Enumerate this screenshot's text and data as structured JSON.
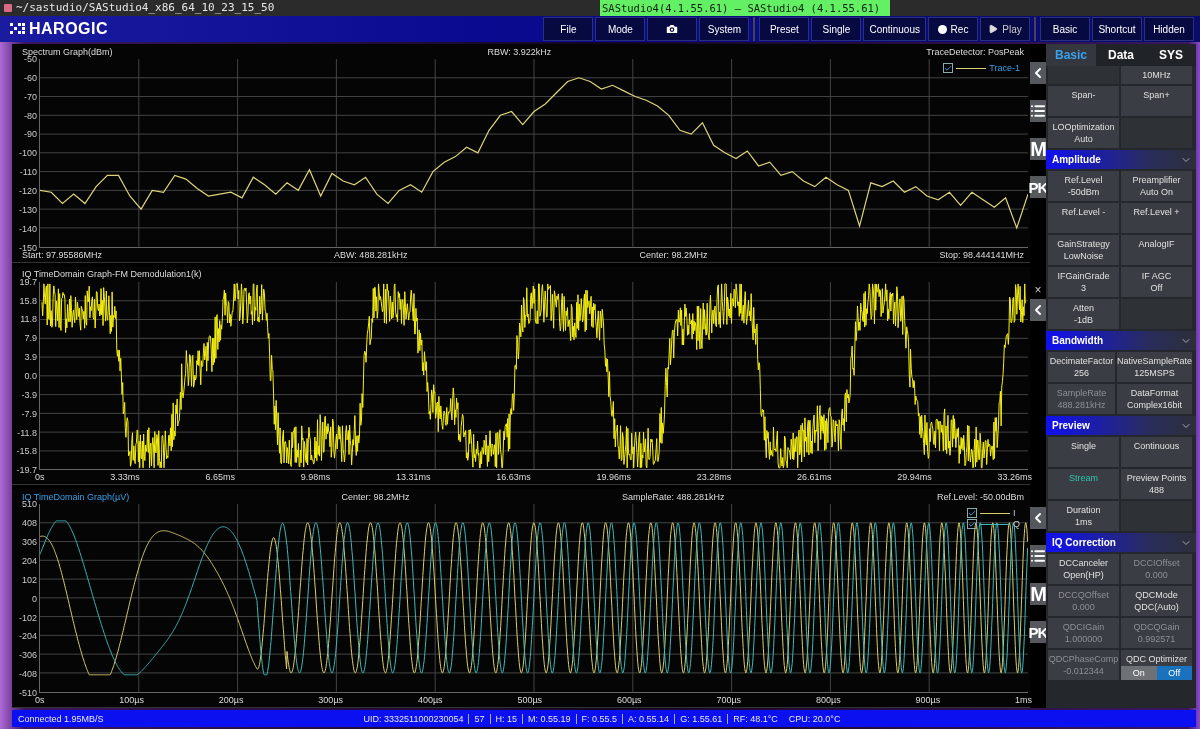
{
  "titlebar": {
    "path": "~/sastudio/SAStudio4_x86_64_10_23_15_50",
    "app": "SAStudio4(4.1.55.61) — SAStudio4 (4.1.55.61)"
  },
  "toolbar": {
    "logo": "HAROGIC",
    "groups": [
      [
        {
          "kind": "text",
          "label": "File"
        },
        {
          "kind": "text",
          "label": "Mode"
        },
        {
          "kind": "camera"
        },
        {
          "kind": "text",
          "label": "System"
        }
      ],
      [
        {
          "kind": "text",
          "label": "Preset"
        },
        {
          "kind": "text",
          "label": "Single"
        },
        {
          "kind": "text",
          "label": "Continuous"
        },
        {
          "kind": "rec",
          "label": "Rec"
        },
        {
          "kind": "play",
          "label": "Play"
        }
      ],
      [
        {
          "kind": "text",
          "label": "Basic"
        },
        {
          "kind": "text",
          "label": "Shortcut"
        },
        {
          "kind": "text",
          "label": "Hidden"
        }
      ]
    ]
  },
  "graphs": [
    {
      "kind": "spectrum",
      "selected": false,
      "title": "Spectrum Graph(dBm)",
      "info": [
        "RBW: 3.922kHz",
        "TraceDetector: PosPeak"
      ],
      "footer": [
        "Start: 97.95586MHz",
        "ABW: 488.281kHz",
        "Center: 98.2MHz",
        "Stop: 98.444141MHz"
      ],
      "legend": [
        {
          "checked": true
        }
      ],
      "chart_data": {
        "type": "line",
        "grid": true,
        "ylim": [
          -150,
          -50
        ],
        "yticks": [
          -50,
          -60,
          -70,
          -80,
          -90,
          -100,
          -110,
          -120,
          -130,
          -140,
          -150
        ],
        "series": [
          {
            "name": "Trace-1",
            "color": "#ddd47a",
            "values": [
              -120,
              -121,
              -127,
              -122,
              -127,
              -118,
              -112,
              -112,
              -123,
              -130,
              -120,
              -121,
              -112,
              -114,
              -119,
              -123,
              -122,
              -121,
              -124,
              -113,
              -117,
              -122,
              -116,
              -120,
              -109,
              -123,
              -111,
              -115,
              -117,
              -113,
              -122,
              -127,
              -120,
              -117,
              -121,
              -110,
              -105,
              -102,
              -97,
              -100,
              -88,
              -80,
              -78,
              -85,
              -78,
              -74,
              -68,
              -62,
              -60,
              -62,
              -66,
              -64,
              -67,
              -70,
              -72,
              -75,
              -80,
              -88,
              -90,
              -84,
              -96,
              -100,
              -103,
              -99,
              -107,
              -105,
              -112,
              -110,
              -115,
              -118,
              -113,
              -117,
              -120,
              -139,
              -116,
              -118,
              -115,
              -121,
              -118,
              -123,
              -125,
              -121,
              -128,
              -121,
              -125,
              -129,
              -124,
              -140,
              -122
            ]
          }
        ]
      },
      "side": [
        {
          "kind": "back"
        },
        {
          "kind": "list"
        },
        {
          "kind": "text",
          "label": "M"
        },
        {
          "kind": "text",
          "label": "PK"
        }
      ]
    },
    {
      "kind": "fm",
      "selected": false,
      "title": "IQ TimeDomain Graph-FM Demodulation1(k)",
      "y_axis_labels": [
        "19.7",
        "15.8",
        "11.8",
        "7.9",
        "3.9",
        "0.0",
        "-3.9",
        "-7.9",
        "-11.8",
        "-15.8",
        "-19.7"
      ],
      "x_axis_labels": [
        "0s",
        "3.33ms",
        "6.65ms",
        "9.98ms",
        "13.31ms",
        "16.63ms",
        "19.96ms",
        "23.28ms",
        "26.61ms",
        "29.94ms",
        "33.26ms"
      ],
      "side": [
        {
          "kind": "close",
          "label": "×"
        },
        {
          "kind": "back"
        }
      ]
    },
    {
      "kind": "iq",
      "selected": true,
      "title": "IQ TimeDomain Graph(µV)",
      "info": [
        "Center: 98.2MHz",
        "SampleRate: 488.281kHz",
        "Ref.Level: -50.00dBm"
      ],
      "y_axis_labels": [
        "510",
        "408",
        "306",
        "204",
        "102",
        "0",
        "-102",
        "-204",
        "-306",
        "-408",
        "-510"
      ],
      "x_axis_labels": [
        "0s",
        "100µs",
        "200µs",
        "300µs",
        "400µs",
        "500µs",
        "600µs",
        "700µs",
        "800µs",
        "900µs",
        "1ms"
      ],
      "legend": [
        {
          "label": "I",
          "checked": true,
          "color": "#d8cf6a"
        },
        {
          "label": "Q",
          "checked": true,
          "color": "#3fb8b8"
        }
      ],
      "side": [
        {
          "kind": "back"
        },
        {
          "kind": "list"
        },
        {
          "kind": "text",
          "label": "M"
        },
        {
          "kind": "text",
          "label": "PK"
        }
      ]
    }
  ],
  "panel": {
    "tabs": [
      {
        "label": "Basic",
        "selected": true
      },
      {
        "label": "Data",
        "selected": false
      },
      {
        "label": "SYS",
        "selected": false
      }
    ],
    "sections": [
      {
        "items": [
          {
            "kind": "empty"
          },
          {
            "kind": "param",
            "label": "10MHz",
            "disabled": false,
            "selected": false
          },
          {
            "kind": "param",
            "label": "Span-",
            "disabled": false,
            "selected": false
          },
          {
            "kind": "param",
            "label": "Span+",
            "disabled": false,
            "selected": false
          },
          {
            "kind": "param",
            "label": "LOOptimization",
            "value": "Auto",
            "disabled": false,
            "selected": false
          },
          {
            "kind": "empty"
          }
        ]
      },
      {
        "title": "Amplitude",
        "expanded": true,
        "items": [
          {
            "kind": "param",
            "label": "Ref.Level",
            "value": "-50dBm",
            "disabled": false,
            "selected": false
          },
          {
            "kind": "param",
            "label": "Preamplifier",
            "value": "Auto On",
            "disabled": false,
            "selected": false
          },
          {
            "kind": "param",
            "label": "Ref.Level -",
            "disabled": false,
            "selected": false
          },
          {
            "kind": "param",
            "label": "Ref.Level +",
            "disabled": false,
            "selected": false
          },
          {
            "kind": "param",
            "label": "GainStrategy",
            "value": "LowNoise",
            "disabled": false,
            "selected": false
          },
          {
            "kind": "param",
            "label": "AnalogIF",
            "disabled": false,
            "selected": false
          },
          {
            "kind": "param",
            "label": "IFGainGrade",
            "value": "3",
            "disabled": false,
            "selected": false
          },
          {
            "kind": "param",
            "label": "IF AGC",
            "value": "Off",
            "disabled": false,
            "selected": false
          },
          {
            "kind": "param",
            "label": "Atten",
            "value": "-1dB",
            "disabled": false,
            "selected": false
          },
          {
            "kind": "empty"
          }
        ]
      },
      {
        "title": "Bandwidth",
        "expanded": true,
        "items": [
          {
            "kind": "param",
            "label": "DecimateFactor",
            "value": "256",
            "disabled": false,
            "selected": false
          },
          {
            "kind": "param",
            "label": "NativeSampleRate",
            "value": "125MSPS",
            "disabled": false,
            "selected": false
          },
          {
            "kind": "param",
            "label": "SampleRate",
            "value": "488.281kHz",
            "disabled": true,
            "selected": false
          },
          {
            "kind": "param",
            "label": "DataFormat",
            "value": "Complex16bit",
            "disabled": false,
            "selected": false
          }
        ]
      },
      {
        "title": "Preview",
        "expanded": true,
        "items": [
          {
            "kind": "param",
            "label": "Single",
            "disabled": false,
            "selected": false
          },
          {
            "kind": "param",
            "label": "Continuous",
            "disabled": false,
            "selected": false
          },
          {
            "kind": "param",
            "label": "Stream",
            "disabled": false,
            "selected": true
          },
          {
            "kind": "param",
            "label": "Preview Points",
            "value": "488",
            "disabled": false,
            "selected": false
          },
          {
            "kind": "param",
            "label": "Duration",
            "value": "1ms",
            "disabled": false,
            "selected": false
          },
          {
            "kind": "empty"
          }
        ]
      },
      {
        "title": "IQ Correction",
        "expanded": true,
        "items": [
          {
            "kind": "param",
            "label": "DCCanceler",
            "value": "Open(HP)",
            "disabled": false,
            "selected": false
          },
          {
            "kind": "param",
            "label": "DCCIOffset",
            "value": "0.000",
            "disabled": true,
            "selected": false
          },
          {
            "kind": "param",
            "label": "DCCQOffset",
            "value": "0.000",
            "disabled": true,
            "selected": false
          },
          {
            "kind": "param",
            "label": "QDCMode",
            "value": "QDC(Auto)",
            "disabled": false,
            "selected": false
          },
          {
            "kind": "param",
            "label": "QDCIGain",
            "value": "1.000000",
            "disabled": true,
            "selected": false
          },
          {
            "kind": "param",
            "label": "QDCQGain",
            "value": "0.992571",
            "disabled": true,
            "selected": false
          },
          {
            "kind": "param",
            "label": "QDCPhaseComp",
            "value": "-0.012344",
            "disabled": true,
            "selected": false
          },
          {
            "kind": "toggle",
            "label": "QDC Optimizer",
            "options": [
              {
                "label": "On",
                "selected": false
              },
              {
                "label": "Off",
                "selected": true
              }
            ]
          }
        ]
      }
    ]
  },
  "status_bar": {
    "connection": "Connected 1.95MB/S",
    "items": [
      {
        "text": "UID: 3332511000230054",
        "divider": true
      },
      {
        "text": "57",
        "divider": true
      },
      {
        "text": "H: 15",
        "divider": true
      },
      {
        "text": "M: 0.55.19",
        "divider": true
      },
      {
        "text": "F: 0.55.5",
        "divider": true
      },
      {
        "text": "A: 0.55.14",
        "divider": true
      },
      {
        "text": "G: 1.55.61",
        "divider": true
      },
      {
        "text": "RF: 48.1°C",
        "divider": false
      },
      {
        "text": "CPU: 20.0°C",
        "divider": false
      }
    ]
  }
}
